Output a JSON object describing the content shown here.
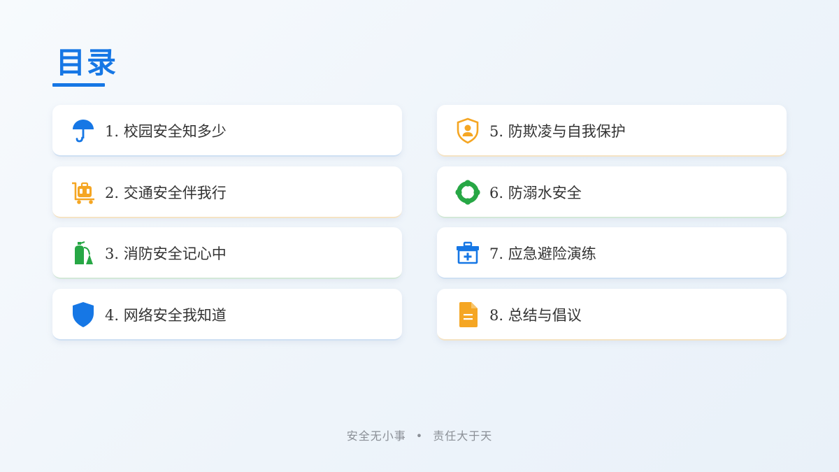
{
  "title": "目录",
  "items": [
    {
      "label": "1.  校园安全知多少",
      "icon": "umbrella-icon",
      "color": "#1677e5"
    },
    {
      "label": "2.  交通安全伴我行",
      "icon": "luggage-cart-icon",
      "color": "#f5a623"
    },
    {
      "label": "3.  消防安全记心中",
      "icon": "fire-extinguisher-icon",
      "color": "#27a745"
    },
    {
      "label": "4.  网络安全我知道",
      "icon": "shield-icon",
      "color": "#1677e5"
    },
    {
      "label": "5.  防欺凌与自我保护",
      "icon": "shield-user-icon",
      "color": "#f5a623"
    },
    {
      "label": "6.  防溺水安全",
      "icon": "lifebuoy-icon",
      "color": "#27a745"
    },
    {
      "label": "7.  应急避险演练",
      "icon": "first-aid-kit-icon",
      "color": "#1677e5"
    },
    {
      "label": "8.  总结与倡议",
      "icon": "document-icon",
      "color": "#f5a623"
    }
  ],
  "footer": {
    "left": "安全无小事",
    "separator": "•",
    "right": "责任大于天"
  }
}
